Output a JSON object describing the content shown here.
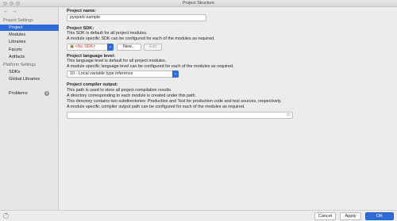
{
  "window": {
    "title": "Project Structure"
  },
  "nav": {
    "back": "←",
    "forward": "→"
  },
  "sidebar": {
    "project_settings": "Project Settings",
    "items_project": [
      "Project",
      "Modules",
      "Libraries",
      "Facets",
      "Artifacts"
    ],
    "platform_settings": "Platform Settings",
    "items_platform": [
      "SDKs",
      "Global Libraries"
    ],
    "problems": "Problems",
    "problems_count": "2"
  },
  "project_name": {
    "label": "Project name:",
    "value": "pyspark-sample"
  },
  "project_sdk": {
    "label": "Project SDK:",
    "desc1": "This SDK is default for all project modules.",
    "desc2": "A module specific SDK can be configured for each of the modules as required.",
    "selected": "<No SDK>",
    "new_button": "New...",
    "edit_button": "Edit"
  },
  "language_level": {
    "label": "Project language level:",
    "desc1": "This language level is default for all project modules.",
    "desc2": "A module specific language level can be configured for each of the modules as required.",
    "selected": "10 - Local variable type inference"
  },
  "compiler_output": {
    "label": "Project compiler output:",
    "desc1": "This path is used to store all project compilation results.",
    "desc2": "A directory corresponding to each module is created under this path.",
    "desc3": "This directory contains two subdirectories: Production and Test for production code and test sources, respectively.",
    "desc4": "A module specific compiler output path can be configured for each of the modules as required.",
    "value": ""
  },
  "footer": {
    "help": "?",
    "cancel": "Cancel",
    "apply": "Apply",
    "ok": "OK"
  },
  "colors": {
    "accent": "#2f6bd8",
    "error": "#c0392b"
  }
}
